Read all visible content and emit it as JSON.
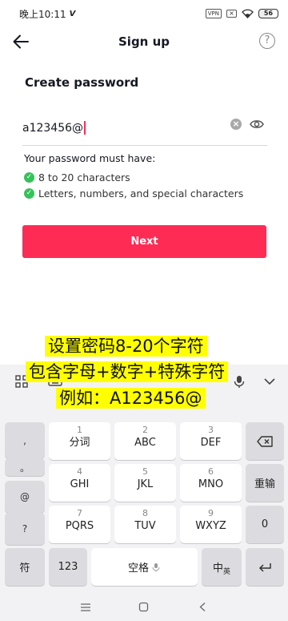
{
  "status_bar": {
    "time": "晚上10:11",
    "carrier_icon": "signal-v-icon",
    "vpn": "VPN",
    "battery": "56"
  },
  "nav": {
    "back_icon": "arrow-left-icon",
    "title": "Sign up",
    "help": "?"
  },
  "form": {
    "section_title": "Create password",
    "password_value": "a123456@",
    "clear_icon": "×",
    "requirements_title": "Your password must have:",
    "requirements": [
      {
        "label": "8 to 20 characters",
        "met": true
      },
      {
        "label": "Letters, numbers, and special characters",
        "met": true
      }
    ],
    "next_label": "Next"
  },
  "overlay": {
    "line1": "设置密码8-20个字符",
    "line2": "包含字母+数字+特殊字符",
    "line3": "例如：A123456@"
  },
  "keyboard": {
    "punct_keys": [
      ",",
      "。",
      "@",
      "?"
    ],
    "keys": [
      {
        "num": "1",
        "letters": "分词"
      },
      {
        "num": "2",
        "letters": "ABC"
      },
      {
        "num": "3",
        "letters": "DEF"
      },
      {
        "num": "4",
        "letters": "GHI"
      },
      {
        "num": "5",
        "letters": "JKL"
      },
      {
        "num": "6",
        "letters": "MNO"
      },
      {
        "num": "7",
        "letters": "PQRS"
      },
      {
        "num": "8",
        "letters": "TUV"
      },
      {
        "num": "9",
        "letters": "WXYZ"
      }
    ],
    "reenter": "重输",
    "zero": "0",
    "symbol": "符",
    "numbers": "123",
    "space": "空格",
    "lang_main": "中",
    "lang_sub": "英"
  },
  "colors": {
    "accent": "#fe2c55",
    "check": "#35c25a",
    "highlight": "#ffff00"
  }
}
